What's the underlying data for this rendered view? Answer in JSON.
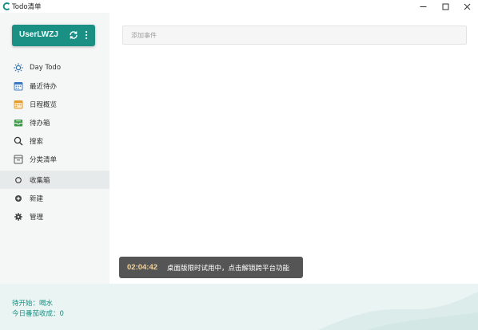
{
  "window": {
    "title": "Todo清单",
    "controls": {
      "minimize": "—",
      "maximize": "☐",
      "close": "✕"
    }
  },
  "user": {
    "name": "UserLWZJ"
  },
  "sidebar": {
    "items": [
      {
        "label": "Day Todo",
        "icon": "sun-icon",
        "active": false
      },
      {
        "label": "最近待办",
        "icon": "calendar-icon",
        "active": false
      },
      {
        "label": "日程概览",
        "icon": "schedule-icon",
        "active": false
      },
      {
        "label": "待办箱",
        "icon": "inbox-icon",
        "active": false
      },
      {
        "label": "搜索",
        "icon": "search-icon",
        "active": false
      },
      {
        "label": "分类清单",
        "icon": "category-list-icon",
        "active": false
      },
      {
        "label": "收集箱",
        "icon": "circle-icon",
        "active": true
      },
      {
        "label": "新建",
        "icon": "add-icon",
        "active": false
      },
      {
        "label": "管理",
        "icon": "gear-icon",
        "active": false
      }
    ]
  },
  "main": {
    "add_event": {
      "placeholder": "添加事件",
      "value": ""
    }
  },
  "toast": {
    "time": "02:04:42",
    "message": "桌面版限时试用中，点击解锁跨平台功能"
  },
  "footer": {
    "line1": "待开始：喝水",
    "line2": "今日番茄收成：0"
  },
  "colors": {
    "accent": "#1a8f83",
    "sidebar_bg": "#f5f7f7",
    "active_bg": "#e7eaea",
    "toast_bg": "#555555",
    "toast_time": "#f3d59b",
    "footer_bg": "#eaf4f3"
  }
}
